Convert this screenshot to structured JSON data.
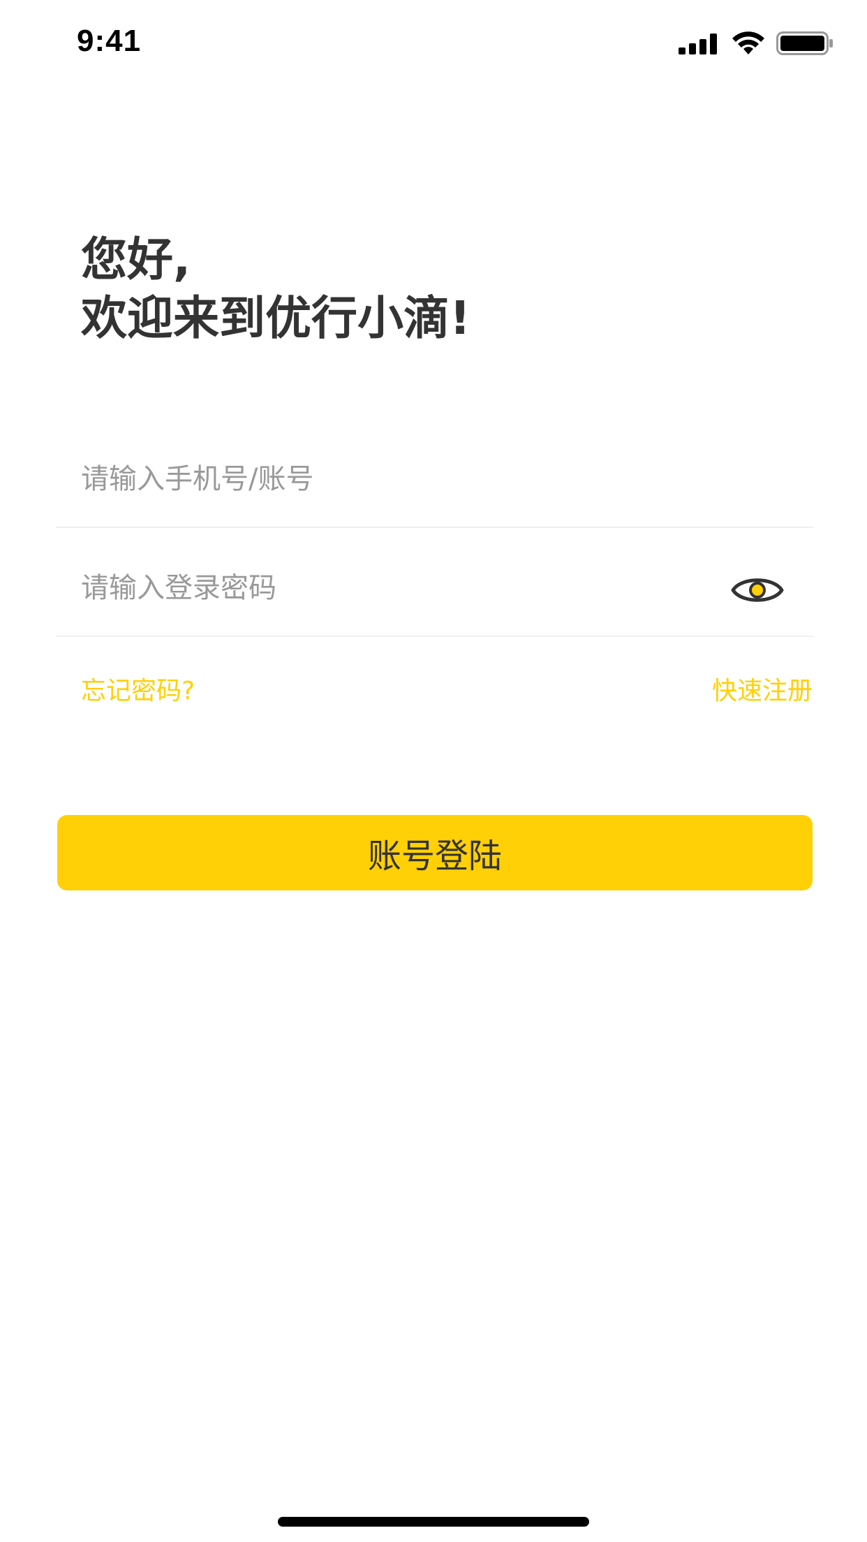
{
  "status_bar": {
    "time": "9:41",
    "signal_icon": "signal-bars-icon",
    "wifi_icon": "wifi-icon",
    "battery_icon": "battery-icon"
  },
  "greeting": {
    "line1": "您好,",
    "line2": "欢迎来到优行小滴!"
  },
  "form": {
    "account_placeholder": "请输入手机号/账号",
    "password_placeholder": "请输入登录密码",
    "eye_icon": "eye-icon"
  },
  "links": {
    "forgot": "忘记密码?",
    "register": "快速注册"
  },
  "login_button": {
    "label": "账号登陆"
  },
  "colors": {
    "accent": "#FFD006",
    "text": "#333333",
    "placeholder": "#999999",
    "divider": "#F0F0F0"
  }
}
